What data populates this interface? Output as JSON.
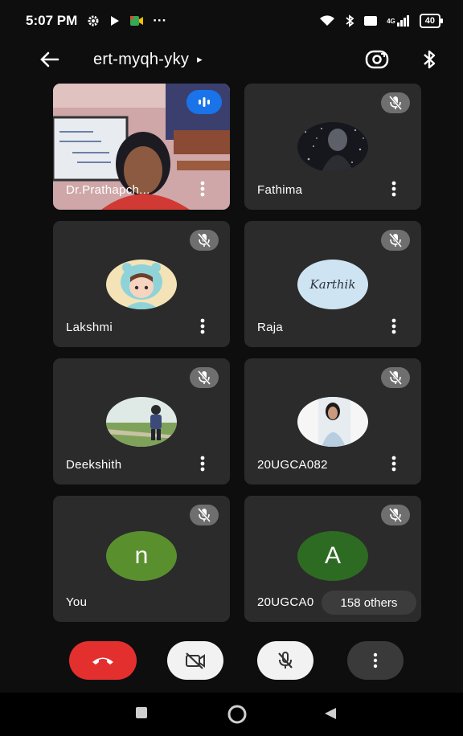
{
  "status_bar": {
    "time": "5:07 PM",
    "dots": "···",
    "network": "4G",
    "battery": "40"
  },
  "header": {
    "meeting_code": "ert-myqh-yky",
    "caret": "▸"
  },
  "participants": [
    {
      "name": "Dr.Prathapch...",
      "speaking": true,
      "video": true
    },
    {
      "name": "Fathima",
      "muted": true
    },
    {
      "name": "Lakshmi",
      "muted": true
    },
    {
      "name": "Raja",
      "muted": true,
      "avatar_text": "Karthik"
    },
    {
      "name": "Deekshith",
      "muted": true
    },
    {
      "name": "20UGCA082",
      "muted": true
    },
    {
      "name": "You",
      "muted": true,
      "avatar_letter": "n"
    },
    {
      "name": "20UGCA0",
      "muted": true,
      "avatar_letter": "A"
    }
  ],
  "others_pill": "158 others",
  "colors": {
    "tile_bg": "#2b2b2b",
    "end_call": "#e3302f",
    "speaking_blue": "#1a73e8",
    "avatar_green_n": "#5a8f2e",
    "avatar_green_a": "#2e6b22"
  }
}
